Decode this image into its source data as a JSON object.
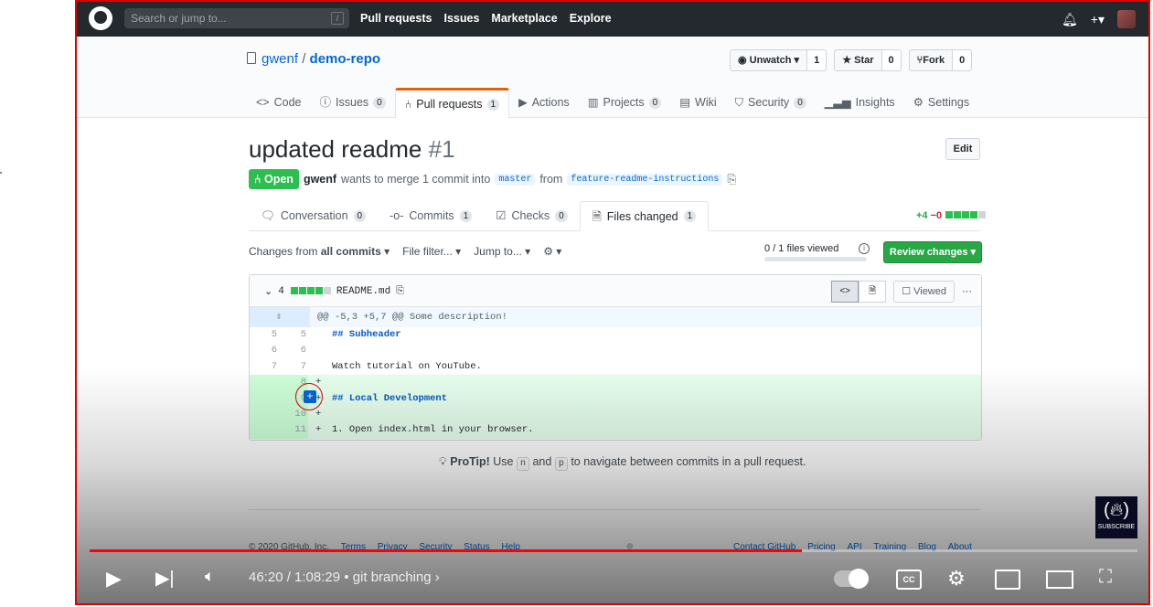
{
  "header": {
    "search_placeholder": "Search or jump to...",
    "search_key": "/",
    "nav": [
      "Pull requests",
      "Issues",
      "Marketplace",
      "Explore"
    ]
  },
  "repo": {
    "owner": "gwenf",
    "separator": "/",
    "name": "demo-repo",
    "watch_label": "Unwatch",
    "watch_count": "1",
    "star_label": "Star",
    "star_count": "0",
    "fork_label": "Fork",
    "fork_count": "0",
    "tabs": [
      {
        "label": "Code",
        "count": ""
      },
      {
        "label": "Issues",
        "count": "0"
      },
      {
        "label": "Pull requests",
        "count": "1"
      },
      {
        "label": "Actions",
        "count": ""
      },
      {
        "label": "Projects",
        "count": "0"
      },
      {
        "label": "Wiki",
        "count": ""
      },
      {
        "label": "Security",
        "count": "0"
      },
      {
        "label": "Insights",
        "count": ""
      },
      {
        "label": "Settings",
        "count": ""
      }
    ]
  },
  "pr": {
    "title": "updated readme",
    "number": "#1",
    "edit_label": "Edit",
    "state": "Open",
    "author": "gwenf",
    "meta_text": "wants to merge 1 commit into",
    "base_branch": "master",
    "from_text": "from",
    "head_branch": "feature-readme-instructions",
    "tabs": [
      {
        "label": "Conversation",
        "count": "0"
      },
      {
        "label": "Commits",
        "count": "1"
      },
      {
        "label": "Checks",
        "count": "0"
      },
      {
        "label": "Files changed",
        "count": "1"
      }
    ],
    "additions": "+4",
    "deletions": "−0"
  },
  "toolbar": {
    "changes_from": "Changes from",
    "all_commits": "all commits",
    "file_filter": "File filter...",
    "jump_to": "Jump to...",
    "files_viewed": "0 / 1 files viewed",
    "review_changes": "Review changes"
  },
  "file": {
    "change_count": "4",
    "name": "README.md",
    "viewed_label": "Viewed",
    "hunk": "@@ -5,3 +5,7 @@ Some description!",
    "lines": [
      {
        "old": "5",
        "new": "5",
        "sign": " ",
        "text": "## Subheader",
        "type": "ctx"
      },
      {
        "old": "6",
        "new": "6",
        "sign": " ",
        "text": "",
        "type": "ctx"
      },
      {
        "old": "7",
        "new": "7",
        "sign": " ",
        "text": "Watch tutorial on YouTube.",
        "type": "ctx"
      },
      {
        "old": "",
        "new": "8",
        "sign": "+",
        "text": "",
        "type": "add"
      },
      {
        "old": "",
        "new": "9",
        "sign": "+",
        "text": "## Local Development",
        "type": "add"
      },
      {
        "old": "",
        "new": "10",
        "sign": "+",
        "text": "",
        "type": "add"
      },
      {
        "old": "",
        "new": "11",
        "sign": "+",
        "text": "1. Open index.html in your browser.",
        "type": "add"
      }
    ]
  },
  "protip": {
    "label": "ProTip!",
    "use": "Use",
    "key1": "n",
    "and": "and",
    "key2": "p",
    "rest": "to navigate between commits in a pull request."
  },
  "footer": {
    "copyright": "© 2020 GitHub, Inc.",
    "left_links": [
      "Terms",
      "Privacy",
      "Security",
      "Status",
      "Help"
    ],
    "right_links": [
      "Contact GitHub",
      "Pricing",
      "API",
      "Training",
      "Blog",
      "About"
    ]
  },
  "video": {
    "time": "46:20 / 1:08:29",
    "bullet": "•",
    "chapter": "git branching",
    "progress_fraction": 0.68,
    "subscribe_label": "SUBSCRIBE"
  }
}
